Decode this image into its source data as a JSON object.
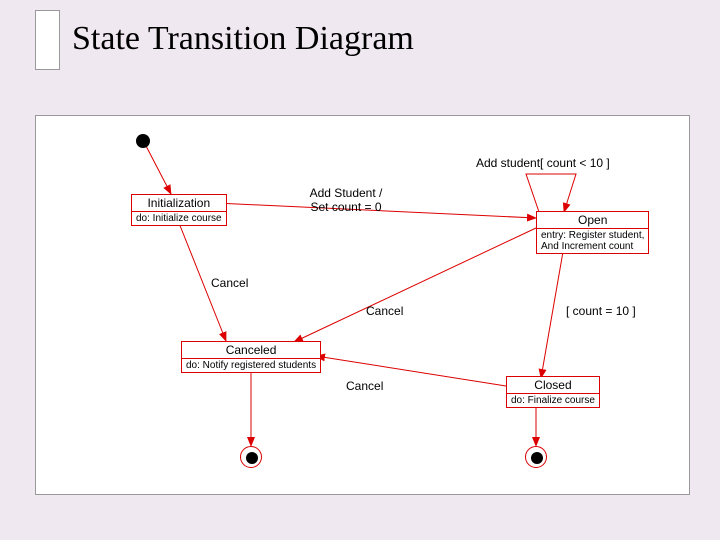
{
  "title": "State Transition Diagram",
  "states": {
    "initialization": {
      "name": "Initialization",
      "detail": "do: Initialize course"
    },
    "open": {
      "name": "Open",
      "detail_line1": "entry: Register student,",
      "detail_line2": "And Increment count"
    },
    "canceled": {
      "name": "Canceled",
      "detail": "do: Notify registered students"
    },
    "closed": {
      "name": "Closed",
      "detail": "do: Finalize course"
    }
  },
  "transitions": {
    "add_student_set": "Add Student /\nSet count = 0",
    "add_student_guard": "Add student[ count < 10 ]",
    "cancel1": "Cancel",
    "cancel2": "Cancel",
    "cancel3": "Cancel",
    "count_eq_10": "[ count = 10 ]"
  }
}
